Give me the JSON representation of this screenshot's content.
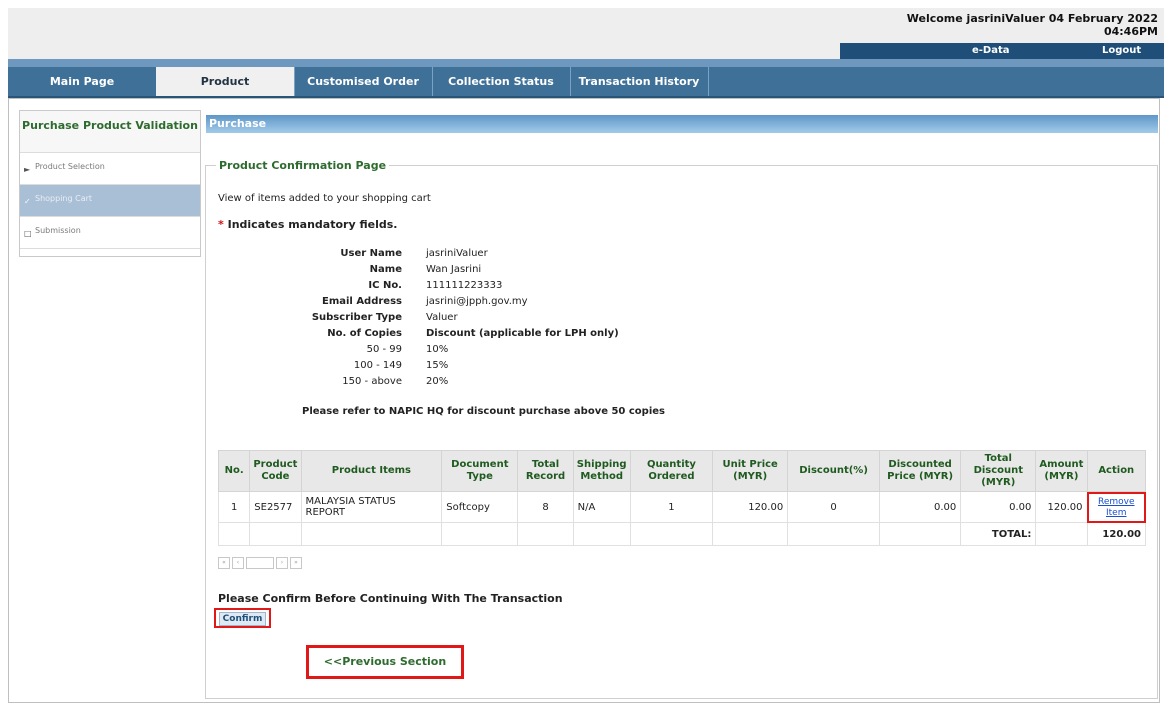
{
  "header": {
    "welcome": "Welcome jasriniValuer 04 February 2022",
    "time": "04:46PM",
    "edata": "e-Data",
    "logout": "Logout"
  },
  "nav": {
    "tabs": [
      {
        "label": "Main Page"
      },
      {
        "label": "Product"
      },
      {
        "label": "Customised Order"
      },
      {
        "label": "Collection Status"
      },
      {
        "label": "Transaction History"
      }
    ],
    "active": "Product"
  },
  "sidebar": {
    "title": "Purchase Product Validation",
    "items": [
      {
        "label": "Product Selection"
      },
      {
        "label": "Shopping Cart"
      },
      {
        "label": "Submission"
      }
    ]
  },
  "section_title": "Purchase",
  "fieldset_legend": "Product Confirmation Page",
  "intro": "View of items added to your shopping cart",
  "mandatory": {
    "star": "*",
    "text": "Indicates mandatory fields."
  },
  "user": {
    "labels": [
      "User Name",
      "Name",
      "IC No.",
      "Email Address",
      "Subscriber Type",
      "No. of Copies"
    ],
    "values": [
      "jasriniValuer",
      "Wan Jasrini",
      "111111223333",
      "jasrini@jpph.gov.my",
      "Valuer",
      "Discount (applicable for LPH only)"
    ]
  },
  "discount_tiers": [
    {
      "range": "50 - 99",
      "pct": "10%"
    },
    {
      "range": "100 - 149",
      "pct": "15%"
    },
    {
      "range": "150 - above",
      "pct": "20%"
    }
  ],
  "refer_note": "Please refer to NAPIC HQ for discount purchase above 50 copies",
  "table": {
    "headers": [
      "No.",
      "Product Code",
      "Product Items",
      "Document Type",
      "Total Record",
      "Shipping Method",
      "Quantity Ordered",
      "Unit Price (MYR)",
      "Discount(%)",
      "Discounted Price (MYR)",
      "Total Discount (MYR)",
      "Amount (MYR)",
      "Action"
    ],
    "row": {
      "no": "1",
      "code": "SE2577",
      "item": "MALAYSIA STATUS REPORT",
      "doc_type": "Softcopy",
      "total_record": "8",
      "shipping": "N/A",
      "qty": "1",
      "unit_price": "120.00",
      "discount": "0",
      "discounted_price": "0.00",
      "total_discount": "0.00",
      "amount": "120.00",
      "action": "Remove Item"
    },
    "total_label": "TOTAL:",
    "total_value": "120.00"
  },
  "confirm_prompt": "Please Confirm Before Continuing With The Transaction",
  "confirm_button": "Confirm",
  "previous_button": "<<Previous Section"
}
